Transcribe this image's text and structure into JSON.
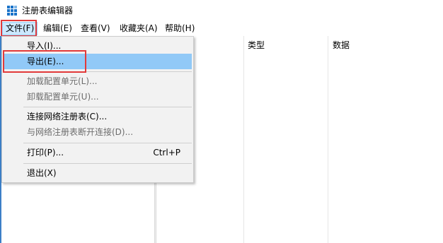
{
  "window": {
    "title": "注册表编辑器",
    "icon": "registry-editor-icon"
  },
  "menubar": {
    "items": [
      {
        "label": "文件(F)",
        "active": true
      },
      {
        "label": "编辑(E)"
      },
      {
        "label": "查看(V)"
      },
      {
        "label": "收藏夹(A)"
      },
      {
        "label": "帮助(H)"
      }
    ]
  },
  "list_headers": {
    "type": "类型",
    "data": "数据"
  },
  "file_menu": {
    "items": [
      {
        "label": "导入(I)...",
        "enabled": true
      },
      {
        "label": "导出(E)...",
        "enabled": true,
        "highlighted": true
      },
      {
        "label": "加载配置单元(L)...",
        "enabled": false
      },
      {
        "label": "卸载配置单元(U)...",
        "enabled": false
      },
      {
        "label": "连接网络注册表(C)...",
        "enabled": true
      },
      {
        "label": "与网络注册表断开连接(D)...",
        "enabled": false
      },
      {
        "label": "打印(P)...",
        "enabled": true,
        "shortcut": "Ctrl+P"
      },
      {
        "label": "退出(X)",
        "enabled": true
      }
    ]
  },
  "colors": {
    "highlight": "#91c9f7",
    "annotation_box": "#e23a3a",
    "menu_background": "#f2f2f2",
    "disabled_text": "#6d6d6d"
  }
}
